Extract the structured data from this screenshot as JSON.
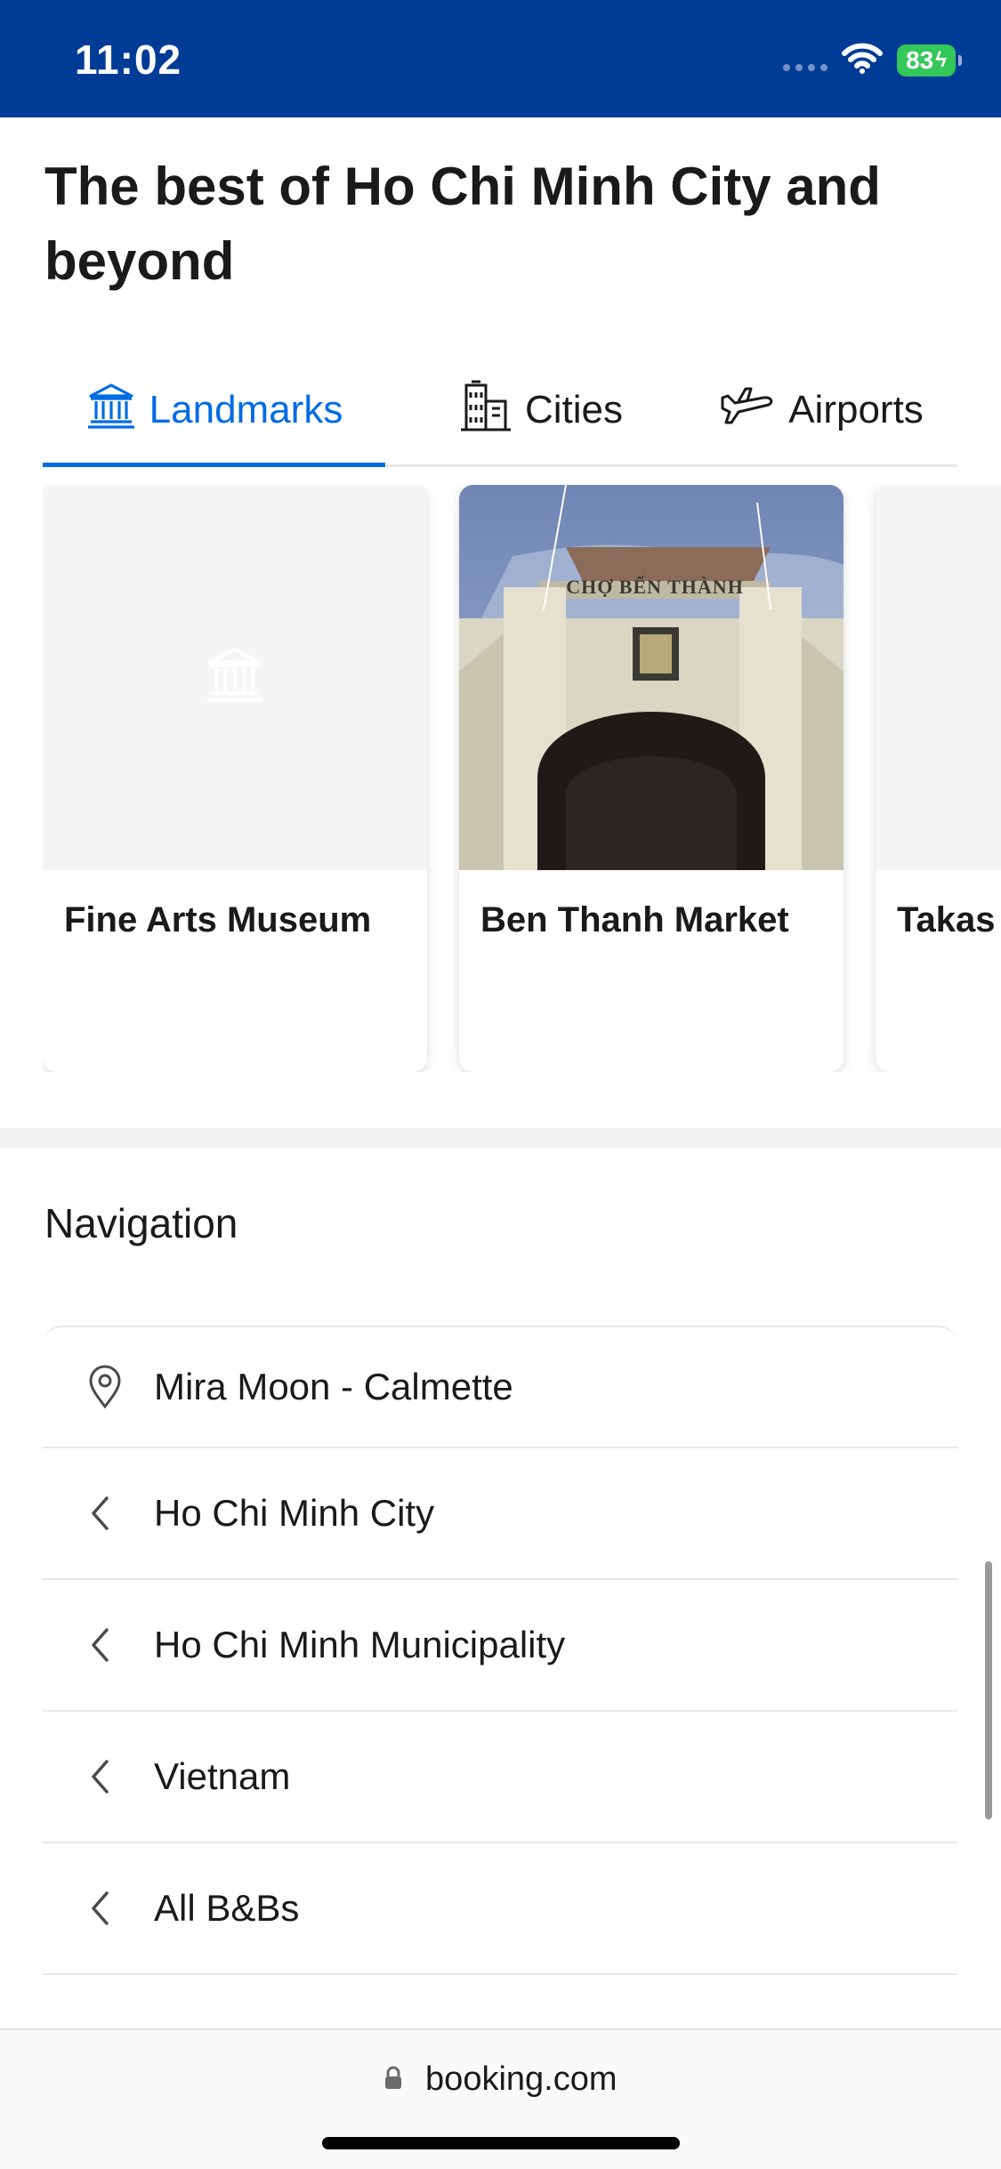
{
  "status_bar": {
    "time": "11:02",
    "battery": "83"
  },
  "header": {
    "title": "The best of Ho Chi Minh City and beyond"
  },
  "tabs": [
    {
      "label": "Landmarks",
      "icon": "landmark-icon",
      "active": true
    },
    {
      "label": "Cities",
      "icon": "city-buildings-icon",
      "active": false
    },
    {
      "label": "Airports",
      "icon": "airplane-icon",
      "active": false
    }
  ],
  "cards": [
    {
      "title": "Fine Arts Museum",
      "image": "placeholder-landmark-icon"
    },
    {
      "title": "Ben Thanh Market",
      "image": "market-gate-photo",
      "sign_text": "CHỢ BẾN THÀNH"
    },
    {
      "title": "Takas Vietna"
    }
  ],
  "navigation": {
    "heading": "Navigation",
    "items": [
      {
        "label": "Mira Moon - Calmette",
        "icon": "map-pin-icon"
      },
      {
        "label": "Ho Chi Minh City",
        "icon": "chevron-left-icon"
      },
      {
        "label": "Ho Chi Minh Municipality",
        "icon": "chevron-left-icon"
      },
      {
        "label": "Vietnam",
        "icon": "chevron-left-icon"
      },
      {
        "label": "All B&Bs",
        "icon": "chevron-left-icon"
      }
    ]
  },
  "browser": {
    "url": "booking.com"
  },
  "colors": {
    "brand_blue": "#003b95",
    "accent_blue": "#006ce4",
    "battery_green": "#34c759"
  }
}
